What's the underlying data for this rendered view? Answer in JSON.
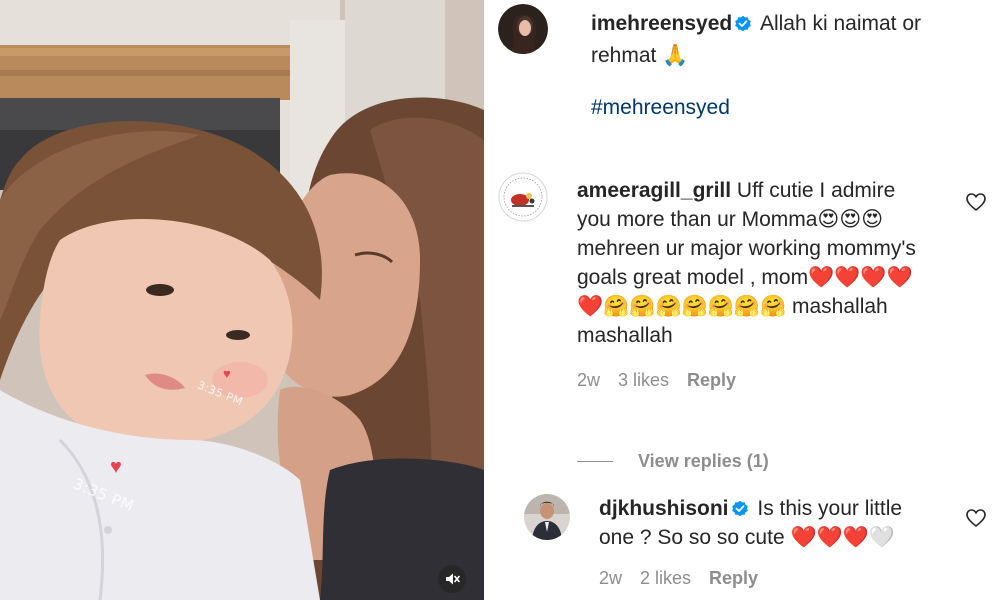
{
  "post": {
    "media": {
      "timestamp_stamp_small": "3:35 PM",
      "timestamp_stamp_large": "3:35 PM",
      "mute_icon": "speaker-muted-icon"
    },
    "caption": {
      "username": "imehreensyed",
      "verified": true,
      "text": "Allah ki naimat or rehmat 🙏",
      "hashtag": "#mehreensyed"
    }
  },
  "comments": [
    {
      "username": "ameeragill_grill",
      "text_line": "Uff cutie I admire you more than ur Momma😍😍😍mehreen ur major working mommy's goals great model , mom❤️❤️❤️❤️❤️🤗🤗🤗🤗🤗🤗🤗 mashallah mashallah",
      "age": "2w",
      "likes": "3 likes",
      "reply_label": "Reply"
    },
    {
      "username": "djkhushisoni",
      "verified": true,
      "text_line": "Is this your little one ? So so so cute ❤️❤️❤️🤍",
      "truncated_text": "Is this your littl...",
      "age": "2w",
      "likes": "2 likes",
      "reply_label": "Reply"
    }
  ],
  "view_replies_label": "View replies (1)",
  "colors": {
    "verified_blue": "#0095f6",
    "hashtag_blue": "#00376b",
    "meta_gray": "#8e8e8e",
    "heart_red": "#ed1c3b"
  }
}
